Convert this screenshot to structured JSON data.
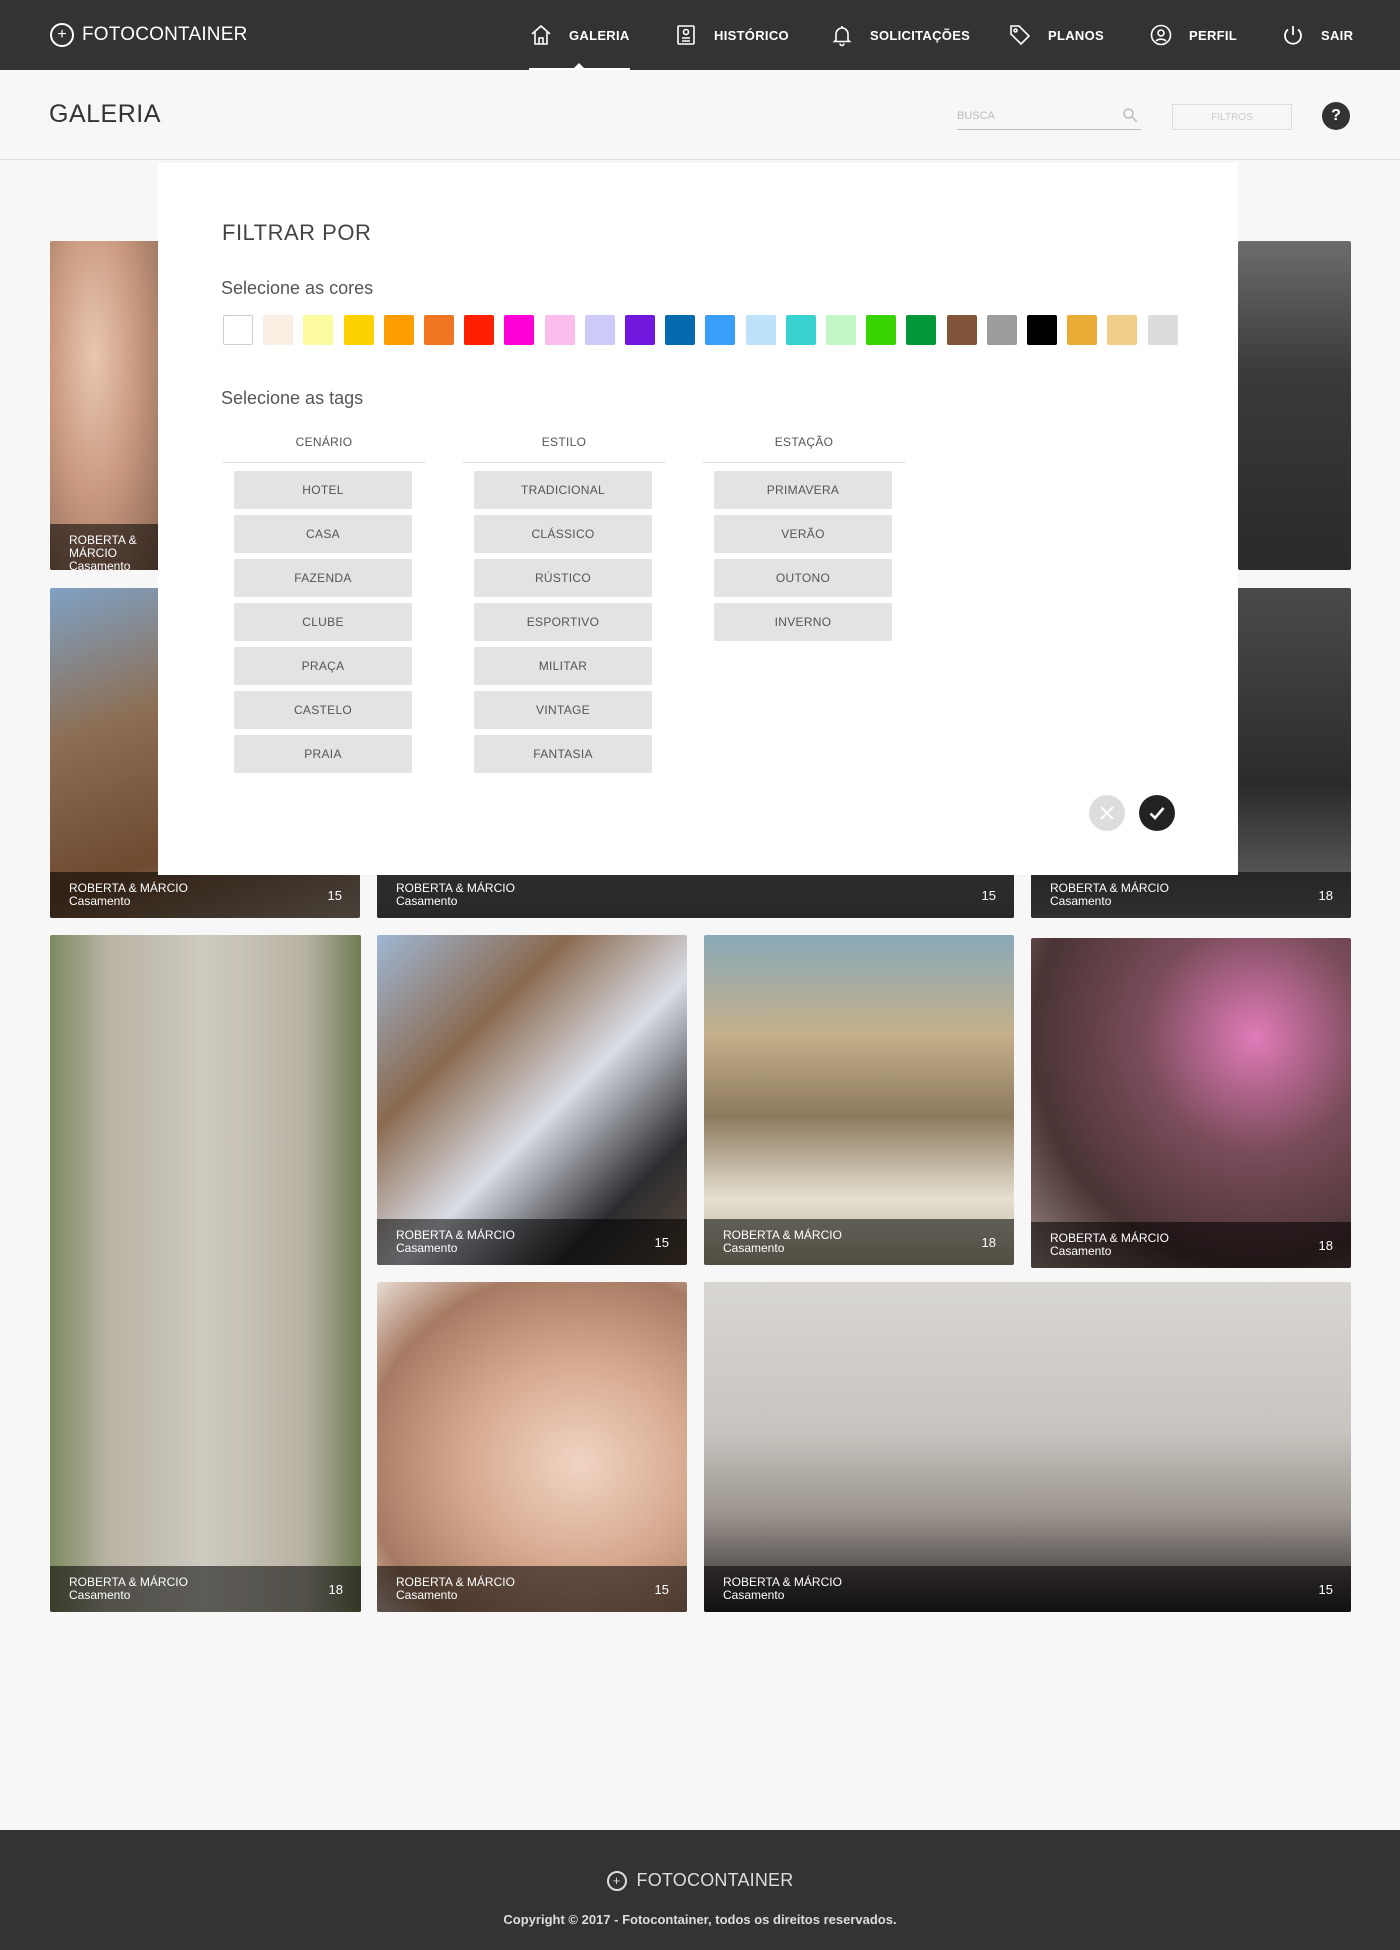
{
  "app": {
    "name": "FOTOCONTAINER"
  },
  "nav": {
    "items": [
      {
        "label": "GALERIA",
        "icon": "home-icon",
        "active": true
      },
      {
        "label": "HISTÓRICO",
        "icon": "history-icon"
      },
      {
        "label": "SOLICITAÇÕES",
        "icon": "bell-icon"
      },
      {
        "label": "PLANOS",
        "icon": "tag-icon"
      },
      {
        "label": "PERFIL",
        "icon": "user-icon"
      },
      {
        "label": "SAIR",
        "icon": "power-icon"
      }
    ]
  },
  "header": {
    "title": "GALERIA",
    "search_placeholder": "BUSCA",
    "filter_label": "FILTROS",
    "help_label": "?"
  },
  "filter_modal": {
    "title": "FILTRAR POR",
    "colors_label": "Selecione as cores",
    "tags_label": "Selecione as tags",
    "colors": [
      "#ffffff",
      "#fbeee2",
      "#fdfb9f",
      "#fdd200",
      "#fd9e00",
      "#f07624",
      "#fe2000",
      "#fe00d7",
      "#fbbeec",
      "#cdc9f8",
      "#6f17dc",
      "#036aad",
      "#3a9ffb",
      "#bde2f9",
      "#38d3d1",
      "#c1f7c7",
      "#38d300",
      "#039837",
      "#825439",
      "#9c9c9c",
      "#000000",
      "#ebab37",
      "#eece89",
      "#dcdcdc"
    ],
    "groups": [
      {
        "name": "CENÁRIO",
        "tags": [
          "HOTEL",
          "CASA",
          "FAZENDA",
          "CLUBE",
          "PRAÇA",
          "CASTELO",
          "PRAIA"
        ]
      },
      {
        "name": "ESTILO",
        "tags": [
          "TRADICIONAL",
          "CLÁSSICO",
          "RÚSTICO",
          "ESPORTIVO",
          "MILITAR",
          "VINTAGE",
          "FANTASIA"
        ]
      },
      {
        "name": "ESTAÇÃO",
        "tags": [
          "PRIMAVERA",
          "VERÃO",
          "OUTONO",
          "INVERNO"
        ]
      }
    ]
  },
  "gallery": [
    {
      "title": "ROBERTA & MÁRCIO",
      "subtitle": "Casamento",
      "count": ""
    },
    {
      "title": "ROBERTA & MÁRCIO",
      "subtitle": "Casamento",
      "count": "15"
    },
    {
      "title": "ROBERTA & MÁRCIO",
      "subtitle": "Casamento",
      "count": "15"
    },
    {
      "title": "ROBERTA & MÁRCIO",
      "subtitle": "Casamento",
      "count": "18"
    },
    {
      "title": "ROBERTA & MÁRCIO",
      "subtitle": "Casamento",
      "count": "18"
    },
    {
      "title": "ROBERTA & MÁRCIO",
      "subtitle": "Casamento",
      "count": "15"
    },
    {
      "title": "ROBERTA & MÁRCIO",
      "subtitle": "Casamento",
      "count": "18"
    },
    {
      "title": "ROBERTA & MÁRCIO",
      "subtitle": "Casamento",
      "count": "18"
    },
    {
      "title": "ROBERTA & MÁRCIO",
      "subtitle": "Casamento",
      "count": "15"
    },
    {
      "title": "ROBERTA & MÁRCIO",
      "subtitle": "Casamento",
      "count": "15"
    }
  ],
  "footer": {
    "brand": "FOTOCONTAINER",
    "copyright": "Copyright © 2017 - Fotocontainer, todos os direitos reservados."
  }
}
